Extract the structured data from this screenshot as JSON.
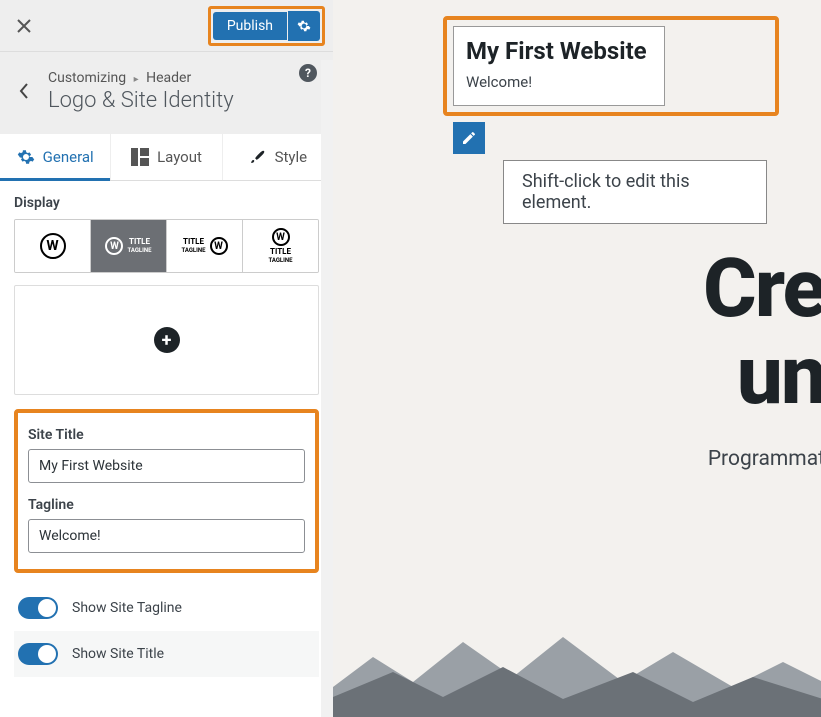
{
  "topbar": {
    "publish_label": "Publish"
  },
  "breadcrumb": {
    "prefix": "Customizing",
    "parent": "Header",
    "title": "Logo & Site Identity"
  },
  "tabs": {
    "general": "General",
    "layout": "Layout",
    "style": "Style"
  },
  "panel": {
    "display_label": "Display",
    "site_title_label": "Site Title",
    "site_title_value": "My First Website",
    "tagline_label": "Tagline",
    "tagline_value": "Welcome!",
    "toggle_tagline": "Show Site Tagline",
    "toggle_title": "Show Site Title"
  },
  "preview": {
    "site_title": "My First Website",
    "tagline": "Welcome!",
    "tooltip": "Shift-click to edit this element.",
    "hero_line1": "Cre",
    "hero_line2": "un",
    "hero_sub": "Programmat"
  }
}
